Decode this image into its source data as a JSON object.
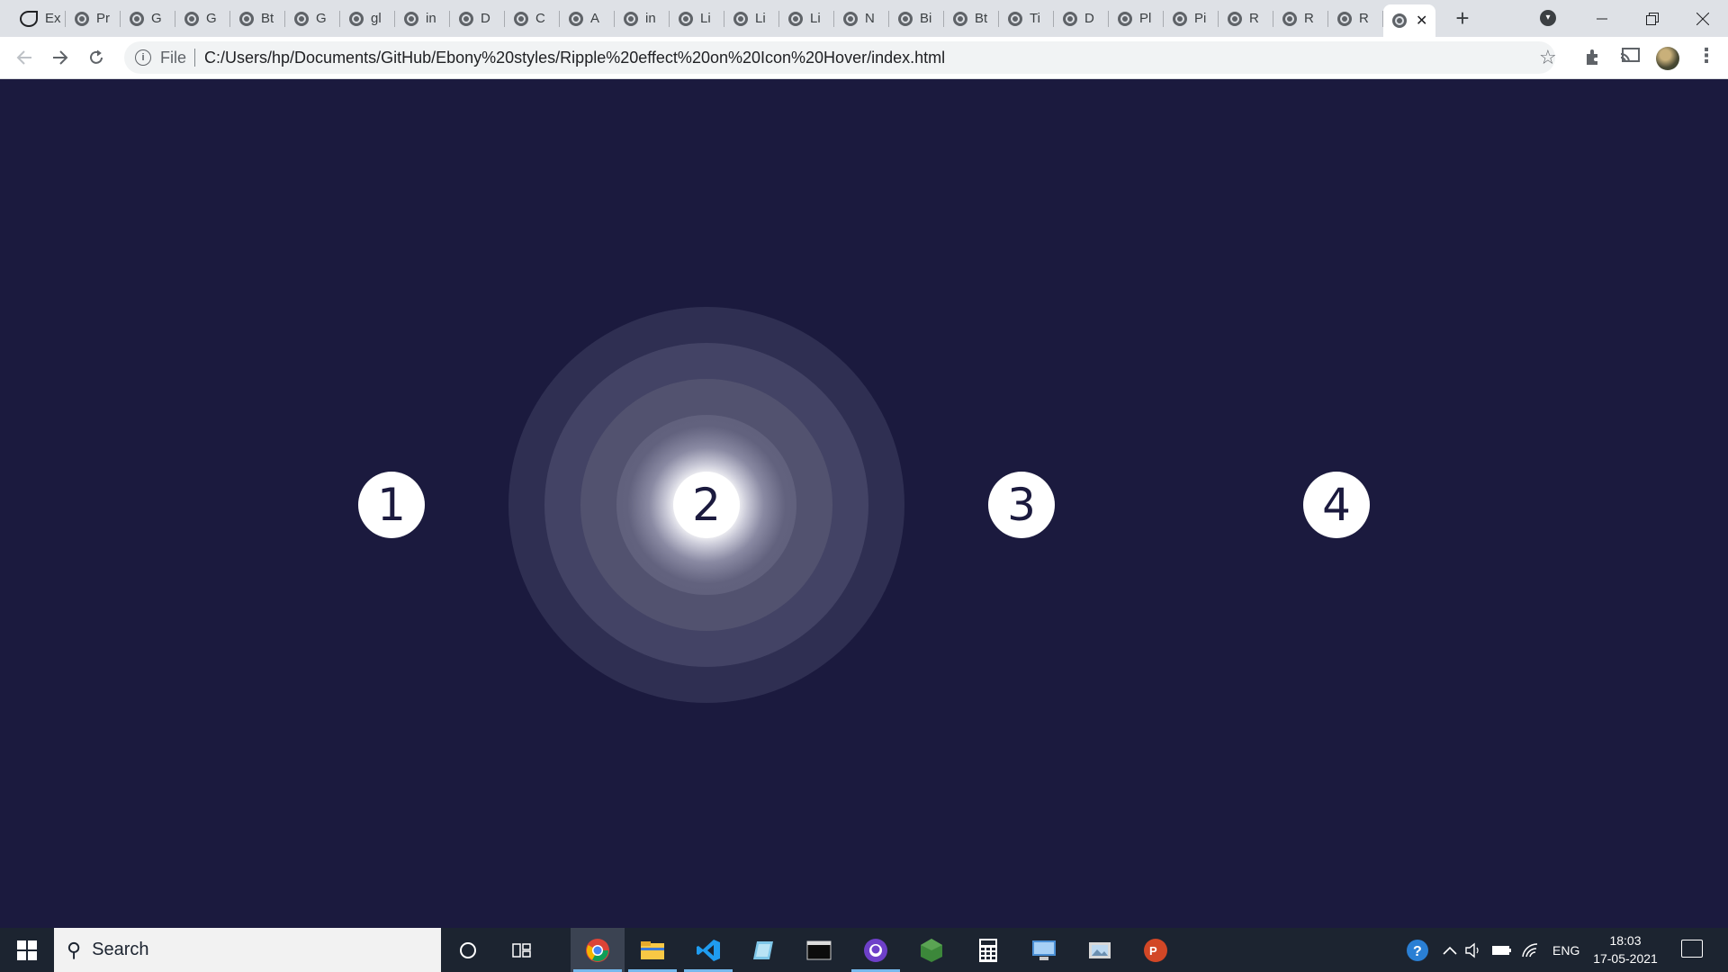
{
  "browser": {
    "tabs": [
      {
        "label": "Ex"
      },
      {
        "label": "Pr"
      },
      {
        "label": "G"
      },
      {
        "label": "G"
      },
      {
        "label": "Bt"
      },
      {
        "label": "G"
      },
      {
        "label": "gl"
      },
      {
        "label": "in"
      },
      {
        "label": "D"
      },
      {
        "label": "C"
      },
      {
        "label": "A"
      },
      {
        "label": "in"
      },
      {
        "label": "Li"
      },
      {
        "label": "Li"
      },
      {
        "label": "Li"
      },
      {
        "label": "N"
      },
      {
        "label": "Bi"
      },
      {
        "label": "Bt"
      },
      {
        "label": "Ti"
      },
      {
        "label": "D"
      },
      {
        "label": "Pl"
      },
      {
        "label": "Pi"
      },
      {
        "label": "R"
      },
      {
        "label": "R"
      },
      {
        "label": "R"
      }
    ],
    "active_tab_close": "✕",
    "new_tab": "+",
    "address": {
      "scheme_label": "File",
      "url": "C:/Users/hp/Documents/GitHub/Ebony%20styles/Ripple%20effect%20on%20Icon%20Hover/index.html"
    }
  },
  "page": {
    "background": "#1b1a3e",
    "icons": [
      {
        "label": "1"
      },
      {
        "label": "2"
      },
      {
        "label": "3"
      },
      {
        "label": "4"
      }
    ],
    "hovered_icon": "2"
  },
  "taskbar": {
    "search_placeholder": "Search",
    "language": "ENG",
    "time": "18:03",
    "date": "17-05-2021"
  }
}
